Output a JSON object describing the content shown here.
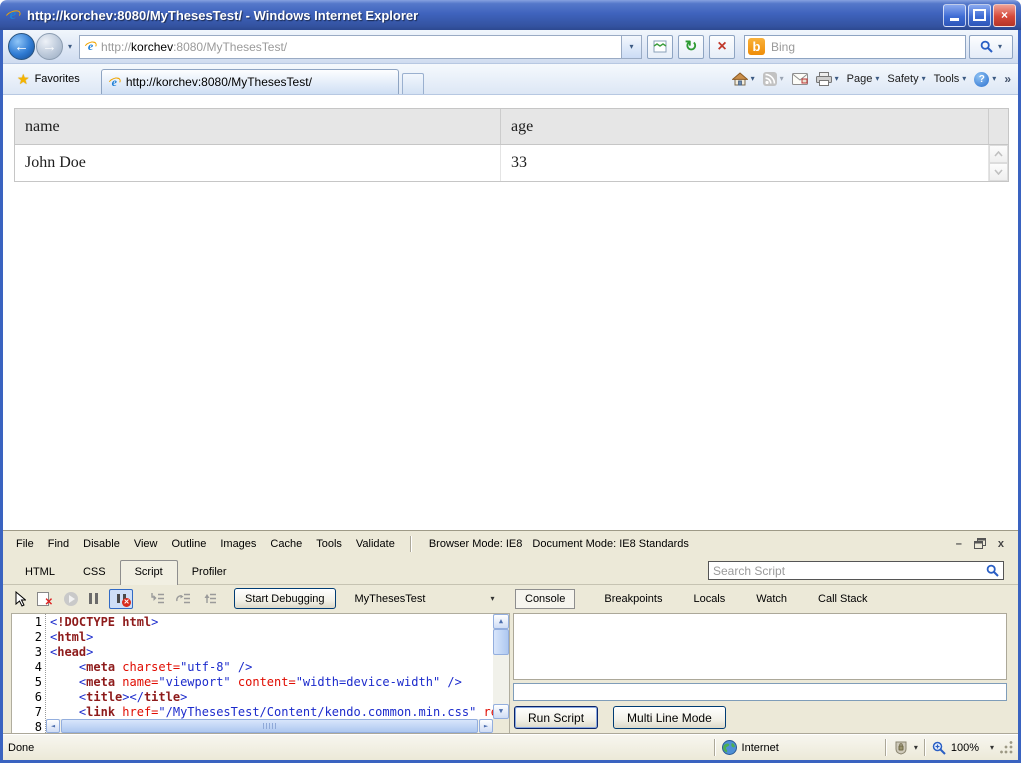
{
  "window": {
    "title": "http://korchev:8080/MyThesesTest/ - Windows Internet Explorer"
  },
  "icons": {
    "back_glyph": "←",
    "forward_glyph": "→",
    "dropdown_glyph": "▾",
    "refresh_glyph": "↻",
    "stop_glyph": "×",
    "star_glyph": "★",
    "bing_logo_glyph": "b",
    "help_glyph": "?",
    "chevron_glyph": "»",
    "minimize_glyph": "–",
    "close_glyph": "×",
    "up_glyph": "▲",
    "down_glyph": "▼",
    "left_glyph": "◄",
    "right_glyph": "►",
    "restore_glyph": "❐"
  },
  "address_bar": {
    "url_protocol": "http://",
    "url_host": "korchev",
    "url_rest": ":8080/MyThesesTest/",
    "search_placeholder": "Bing"
  },
  "tabs_bar": {
    "favorites_label": "Favorites",
    "tab_title": "http://korchev:8080/MyThesesTest/",
    "page_label": "Page",
    "safety_label": "Safety",
    "tools_label": "Tools"
  },
  "content": {
    "grid": {
      "columns": [
        "name",
        "age"
      ],
      "rows": [
        [
          "John Doe",
          "33"
        ]
      ]
    }
  },
  "devtools": {
    "menu": [
      "File",
      "Find",
      "Disable",
      "View",
      "Outline",
      "Images",
      "Cache",
      "Tools",
      "Validate"
    ],
    "browser_mode": "Browser Mode: IE8",
    "document_mode": "Document Mode: IE8 Standards",
    "tabs": [
      "HTML",
      "CSS",
      "Script",
      "Profiler"
    ],
    "active_tab": "Script",
    "search_placeholder": "Search Script",
    "toolbar": {
      "start_debugging_label": "Start Debugging",
      "context_value": "MyThesesTest"
    },
    "panel_tabs": [
      "Console",
      "Breakpoints",
      "Locals",
      "Watch",
      "Call Stack"
    ],
    "active_panel_tab": "Console",
    "code": {
      "lines": [
        {
          "n": "1",
          "tokens": [
            [
              "p",
              "<"
            ],
            [
              "t",
              "!DOCTYPE html"
            ],
            [
              "p",
              ">"
            ]
          ]
        },
        {
          "n": "2",
          "tokens": [
            [
              "p",
              "<"
            ],
            [
              "t",
              "html"
            ],
            [
              "p",
              ">"
            ]
          ]
        },
        {
          "n": "3",
          "tokens": [
            [
              "p",
              "<"
            ],
            [
              "t",
              "head"
            ],
            [
              "p",
              ">"
            ]
          ]
        },
        {
          "n": "4",
          "tokens": [
            [
              "x",
              "    "
            ],
            [
              "p",
              "<"
            ],
            [
              "t",
              "meta"
            ],
            [
              "x",
              " "
            ],
            [
              "a",
              "charset="
            ],
            [
              "v",
              "\"utf-8\""
            ],
            [
              "x",
              " "
            ],
            [
              "p",
              "/>"
            ]
          ]
        },
        {
          "n": "5",
          "tokens": [
            [
              "x",
              "    "
            ],
            [
              "p",
              "<"
            ],
            [
              "t",
              "meta"
            ],
            [
              "x",
              " "
            ],
            [
              "a",
              "name="
            ],
            [
              "v",
              "\"viewport\""
            ],
            [
              "x",
              " "
            ],
            [
              "a",
              "content="
            ],
            [
              "v",
              "\"width=device-width\""
            ],
            [
              "x",
              " "
            ],
            [
              "p",
              "/>"
            ]
          ]
        },
        {
          "n": "6",
          "tokens": [
            [
              "x",
              "    "
            ],
            [
              "p",
              "<"
            ],
            [
              "t",
              "title"
            ],
            [
              "p",
              "></"
            ],
            [
              "t",
              "title"
            ],
            [
              "p",
              ">"
            ]
          ]
        },
        {
          "n": "7",
          "tokens": [
            [
              "x",
              "    "
            ],
            [
              "p",
              "<"
            ],
            [
              "t",
              "link"
            ],
            [
              "x",
              " "
            ],
            [
              "a",
              "href="
            ],
            [
              "v",
              "\"/MyThesesTest/Content/kendo.common.min.css\""
            ],
            [
              "x",
              " "
            ],
            [
              "a",
              "re"
            ]
          ]
        },
        {
          "n": "8",
          "tokens": []
        }
      ]
    },
    "console": {
      "run_script_label": "Run Script",
      "multi_line_mode_label": "Multi Line Mode"
    }
  },
  "status_bar": {
    "status": "Done",
    "zone": "Internet",
    "zoom": "100%"
  }
}
